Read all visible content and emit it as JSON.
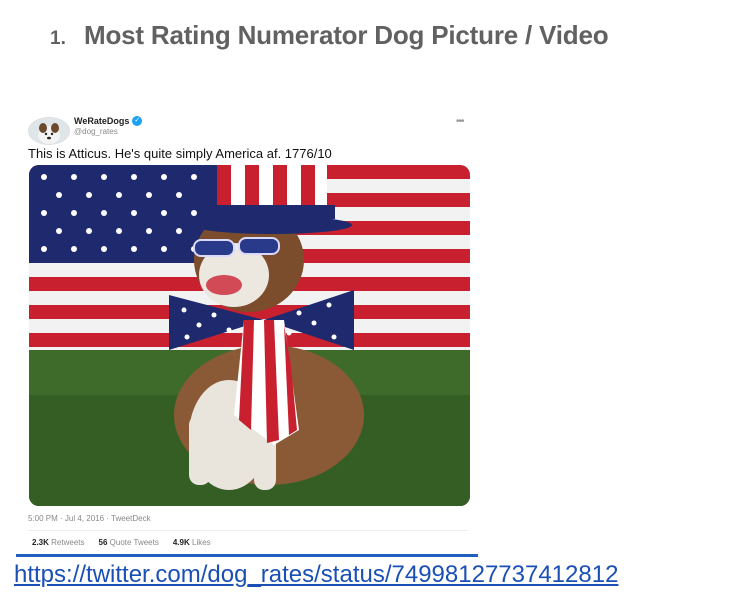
{
  "heading": {
    "number": "1.",
    "title": "Most Rating Numerator Dog Picture / Video"
  },
  "tweet": {
    "display_name": "WeRateDogs",
    "handle": "@dog_rates",
    "more_icon": "ellipsis-icon",
    "text": "This is Atticus. He's quite simply America af. 1776/10",
    "meta": "5:00 PM · Jul 4, 2016 · TweetDeck",
    "stats": {
      "retweets_count": "2.3K",
      "retweets_label": "Retweets",
      "quotes_count": "56",
      "quotes_label": "Quote Tweets",
      "likes_count": "4.9K",
      "likes_label": "Likes"
    },
    "colors": {
      "verified": "#1da1f2",
      "flag_red": "#c8202f",
      "flag_blue": "#1f2a6e"
    }
  },
  "link": {
    "text": "https://twitter.com/dog_rates/status/74998127737412812"
  }
}
